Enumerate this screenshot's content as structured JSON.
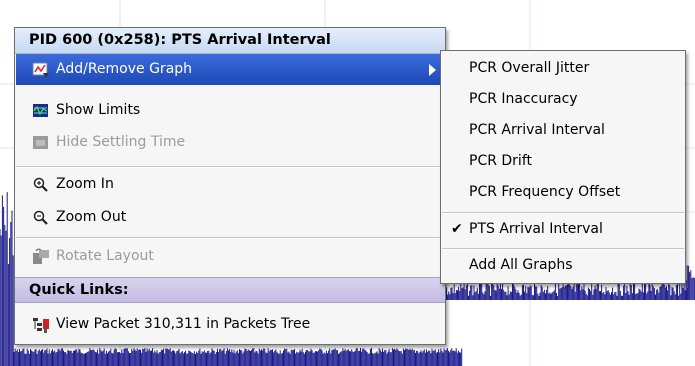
{
  "menu": {
    "header": "PID 600 (0x258): PTS Arrival Interval",
    "items": [
      {
        "label": "Add/Remove Graph",
        "icon": "graph-icon",
        "enabled": true,
        "has_submenu": true,
        "highlighted": true
      },
      {
        "label": "Show Limits",
        "icon": "limits-icon",
        "enabled": true
      },
      {
        "label": "Hide Settling Time",
        "icon": "settling-time-icon",
        "enabled": false
      },
      {
        "label": "Zoom In",
        "icon": "zoom-in-icon",
        "enabled": true
      },
      {
        "label": "Zoom Out",
        "icon": "zoom-out-icon",
        "enabled": true
      },
      {
        "label": "Rotate Layout",
        "icon": "rotate-layout-icon",
        "enabled": false
      }
    ],
    "quick_links_header": "Quick Links:",
    "quick_links": [
      {
        "label": "View Packet 310,311 in Packets Tree",
        "icon": "packet-tree-icon",
        "enabled": true
      }
    ]
  },
  "submenu": {
    "items": [
      {
        "label": "PCR Overall Jitter",
        "checked": false
      },
      {
        "label": "PCR Inaccuracy",
        "checked": false
      },
      {
        "label": "PCR Arrival Interval",
        "checked": false
      },
      {
        "label": "PCR Drift",
        "checked": false
      },
      {
        "label": "PCR Frequency Offset",
        "checked": false
      },
      {
        "label": "PTS Arrival Interval",
        "checked": true
      },
      {
        "label": "Add All Graphs",
        "checked": false
      }
    ],
    "check_glyph": "✔"
  },
  "colors": {
    "highlight": "#2a55c8",
    "graph_line": "#1a1a8c",
    "menu_header": "#d3e2f6",
    "quick_links_header": "#cbc3e6",
    "disabled_text": "#9c9c9c"
  }
}
